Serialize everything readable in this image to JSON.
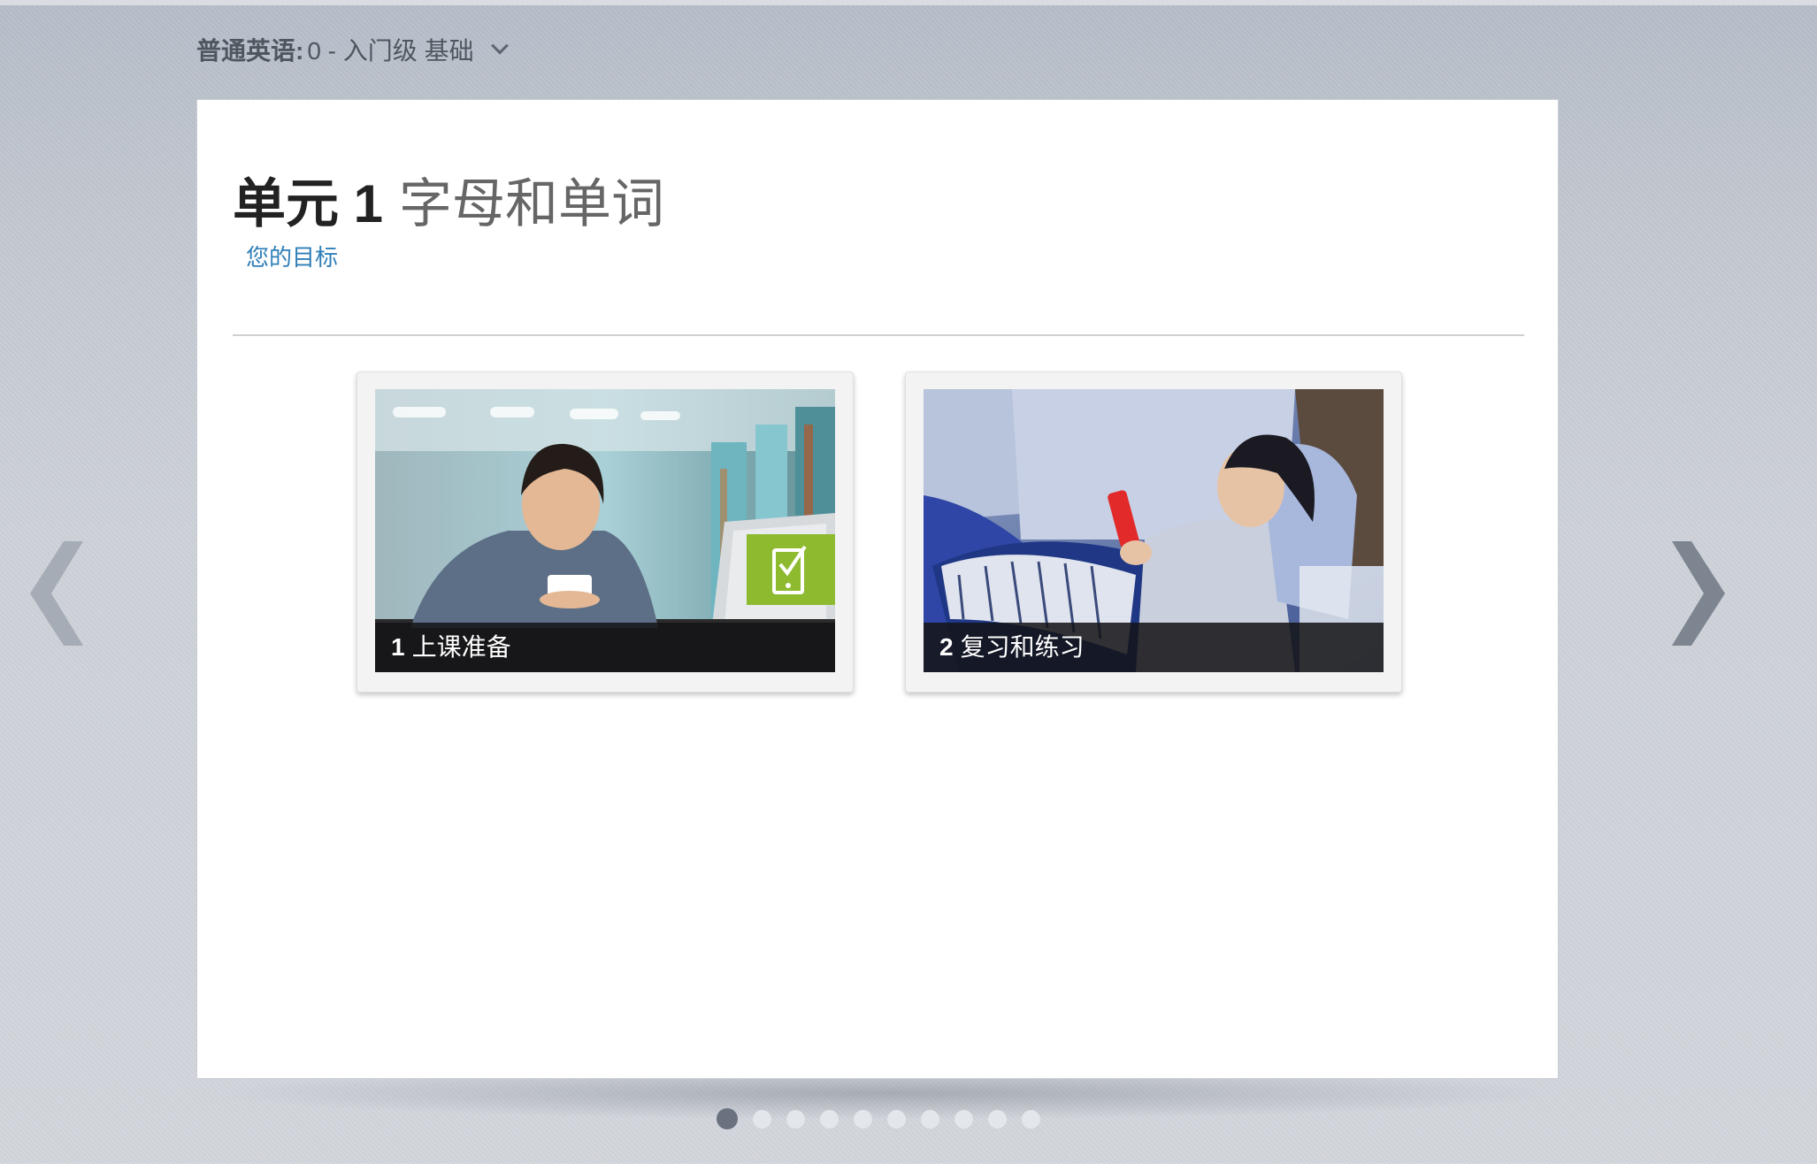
{
  "course": {
    "name": "普通英语:",
    "level": "0 - 入门级 基础",
    "dropdown_icon": "chevron-down-icon"
  },
  "unit": {
    "label": "单元 1",
    "name": "字母和单词",
    "goals_link": "您的目标"
  },
  "lessons": [
    {
      "number": "1",
      "title": "上课准备",
      "image": "girl-with-phone-in-library",
      "badge_icon": "mobile-check-icon",
      "badge_color": "#8dba2f"
    },
    {
      "number": "2",
      "title": "复习和练习",
      "image": "woman-with-phone-on-sofa"
    }
  ],
  "navigation": {
    "prev_icon": "chevron-left-icon",
    "next_icon": "chevron-right-icon"
  },
  "pager": {
    "total_pages": 10,
    "current_page": 1
  },
  "colors": {
    "link": "#2f7fb8",
    "badge": "#8dba2f",
    "active_dot": "#6a7280"
  }
}
